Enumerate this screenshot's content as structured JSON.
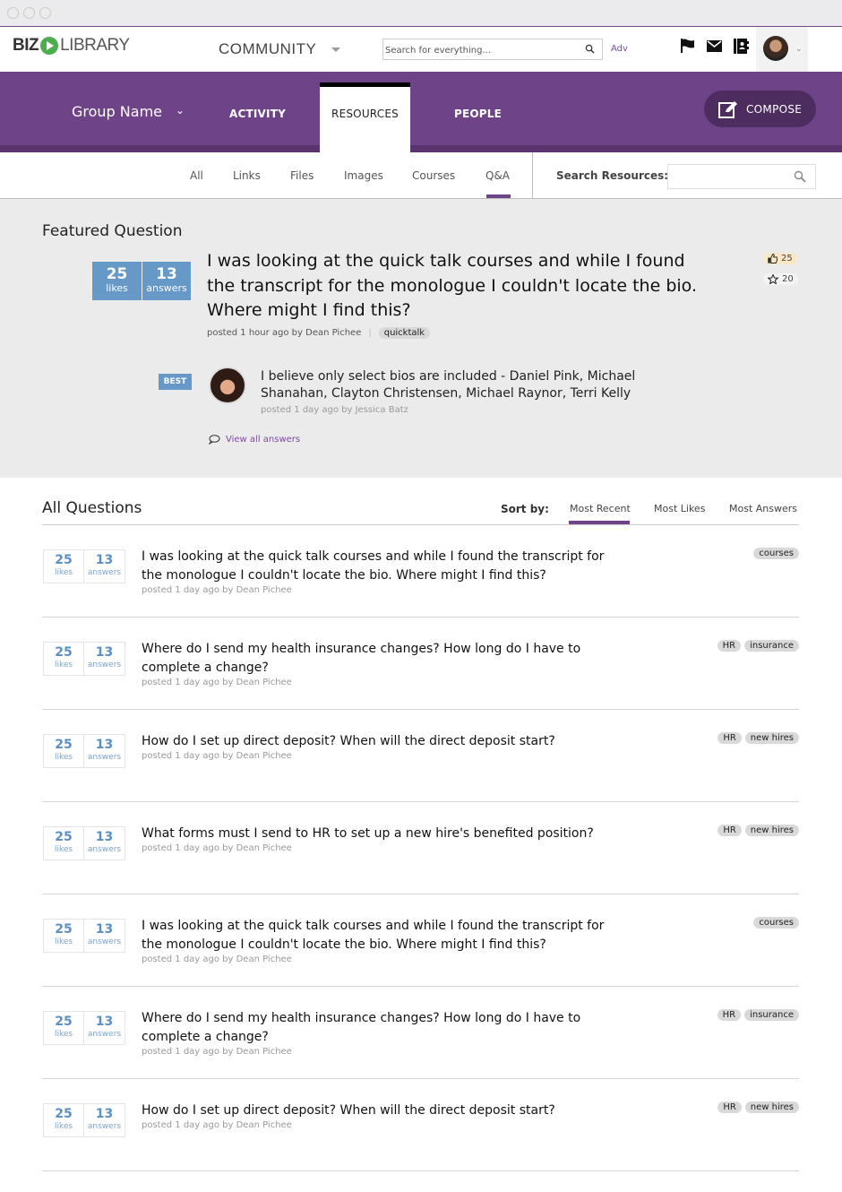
{
  "header": {
    "logo_bold": "BIZ",
    "logo_light": "LIBRARY",
    "section": "COMMUNITY",
    "search_placeholder": "Search for everything...",
    "adv_label": "Adv",
    "icons": [
      "flag-icon",
      "mail-icon",
      "contacts-icon"
    ]
  },
  "group_nav": {
    "group_name": "Group Name",
    "tabs": [
      {
        "label": "ACTIVITY",
        "active": false
      },
      {
        "label": "RESOURCES",
        "active": true
      },
      {
        "label": "PEOPLE",
        "active": false
      }
    ],
    "compose_label": "COMPOSE"
  },
  "resource_tabs": {
    "items": [
      {
        "label": "All"
      },
      {
        "label": "Links"
      },
      {
        "label": "Files"
      },
      {
        "label": "Images"
      },
      {
        "label": "Courses"
      },
      {
        "label": "Q&A",
        "active": true
      }
    ],
    "search_label": "Search Resources:",
    "search_value": ""
  },
  "featured": {
    "title": "Featured Question",
    "likes": "25",
    "likes_label": "likes",
    "answers": "13",
    "answers_label": "answers",
    "question": "I was looking at the quick talk courses and while I found the transcript for the monologue I couldn't locate the bio. Where might I find this?",
    "meta": "posted 1 hour ago by Dean Pichee",
    "tag": "quicktalk",
    "like_count": "25",
    "star_count": "20",
    "best_label": "BEST",
    "best_answer": "I believe only select bios are included - Daniel Pink, Michael Shanahan, Clayton Christensen, Michael Raynor, Terri Kelly",
    "best_answer_meta": "posted 1 day ago by Jessica Batz",
    "view_all_label": "View all answers"
  },
  "all_questions": {
    "title": "All Questions",
    "sort_label": "Sort by:",
    "sort_options": [
      {
        "label": "Most Recent",
        "active": true
      },
      {
        "label": "Most Likes",
        "active": false
      },
      {
        "label": "Most Answers",
        "active": false
      }
    ],
    "likes_label": "likes",
    "answers_label": "answers",
    "items": [
      {
        "likes": "25",
        "answers": "13",
        "question": "I was looking at the quick talk courses and while I found the transcript for the monologue I couldn't locate the bio. Where might I find this?",
        "meta": "posted 1 day ago by Dean Pichee",
        "tags": [
          "courses"
        ]
      },
      {
        "likes": "25",
        "answers": "13",
        "question": "Where do I send my health insurance changes? How long do I have to complete a change?",
        "meta": "posted 1 day ago by Dean Pichee",
        "tags": [
          "HR",
          "insurance"
        ]
      },
      {
        "likes": "25",
        "answers": "13",
        "question": "How do I set up direct deposit? When will the direct deposit start?",
        "meta": "posted 1 day ago by Dean Pichee",
        "tags": [
          "HR",
          "new hires"
        ]
      },
      {
        "likes": "25",
        "answers": "13",
        "question": "What forms must I send to HR to set up a new hire's benefited position?",
        "meta": "posted 1 day ago by Dean Pichee",
        "tags": [
          "HR",
          "new hires"
        ]
      },
      {
        "likes": "25",
        "answers": "13",
        "question": "I was looking at the quick talk courses and while I found the transcript for the monologue I couldn't locate the bio. Where might I find this?",
        "meta": "posted 1 day ago by Dean Pichee",
        "tags": [
          "courses"
        ]
      },
      {
        "likes": "25",
        "answers": "13",
        "question": "Where do I send my health insurance changes? How long do I have to complete a change?",
        "meta": "posted 1 day ago by Dean Pichee",
        "tags": [
          "HR",
          "insurance"
        ]
      },
      {
        "likes": "25",
        "answers": "13",
        "question": "How do I set up direct deposit? When will the direct deposit start?",
        "meta": "posted 1 day ago by Dean Pichee",
        "tags": [
          "HR",
          "new hires"
        ]
      }
    ]
  },
  "colors": {
    "brand_purple": "#6e4388",
    "compose_bg": "#4d2d60",
    "stat_blue": "#6698c8",
    "link_purple": "#7b4a9a"
  }
}
